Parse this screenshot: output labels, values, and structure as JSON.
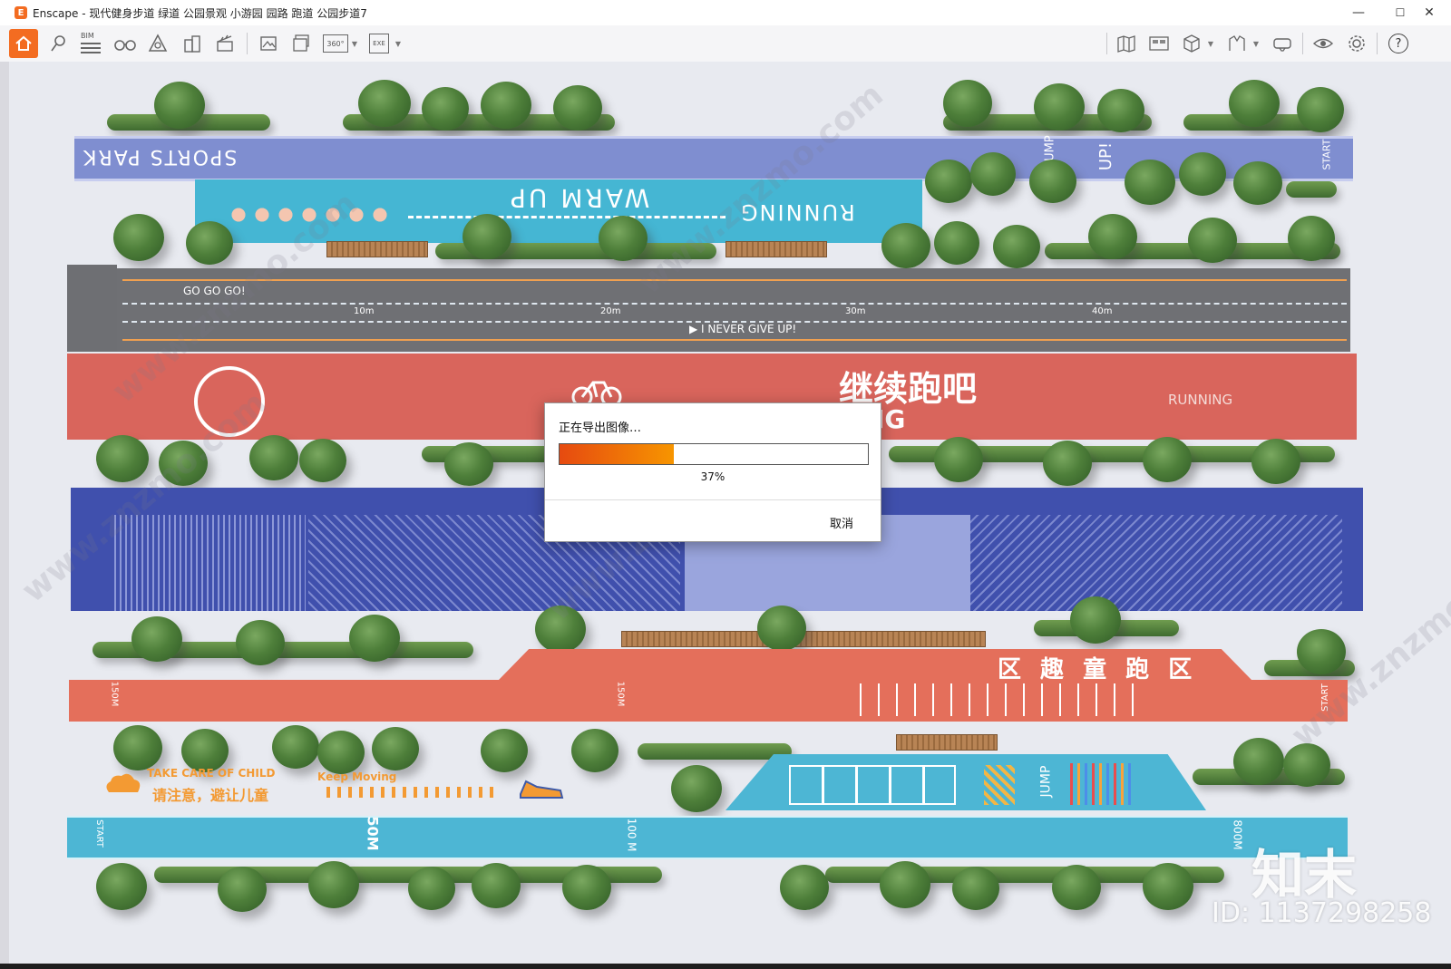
{
  "window": {
    "title": "Enscape - 现代健身步道 绿道 公园景观 小游园 园路 跑道 公园步道7",
    "minimize_glyph": "—",
    "maximize_glyph": "☐",
    "close_glyph": "✕"
  },
  "toolbar": {
    "left_icons": [
      "home-icon",
      "location-pin-icon",
      "bim-icon",
      "binoculars-icon",
      "asset-library-icon",
      "buildings-icon",
      "clapperboard-icon",
      "render-image-icon",
      "batch-render-icon",
      "render-360-icon",
      "export-exe-icon"
    ],
    "bim_label": "BIM",
    "pano_label": "360°",
    "exe_label": "EXE",
    "right_icons": [
      "map-icon",
      "views-icon",
      "cube-icon",
      "material-icon",
      "vr-headset-icon",
      "eye-icon",
      "settings-icon",
      "help-icon"
    ],
    "help_glyph": "?",
    "collapse_glyph": "︿",
    "accent_color": "#f36c21"
  },
  "scene": {
    "sports_park": "SPORTS PARK",
    "jump": "JUMP",
    "up": "UP!",
    "start": "START",
    "warm_up": "WARM UP",
    "running_top": "RUNNING",
    "go_go_go": "GO GO GO!",
    "never_give_up": "▶ I NEVER GIVE UP!",
    "m10": "10m",
    "m20": "20m",
    "m30": "30m",
    "m40": "40m",
    "continue_run": "继续跑吧",
    "ng": "NG",
    "running_red": "RUNNING",
    "take_care": "TAKE CARE OF CHILD",
    "keep_moving": "Keep Moving",
    "please_note": "请注意，避让儿童",
    "zone_text": "区 趣 童 跑 区",
    "m150": "150M",
    "m50": "50M",
    "m100": "100 M",
    "m800": "800M",
    "jump2": "JUMP",
    "start_left": "START",
    "watermark_text": "www.znzmo.com",
    "logo": "知末",
    "id_text": "ID: 1137298258"
  },
  "dialog": {
    "message": "正在导出图像…",
    "progress": 0.37,
    "percent_label": "37%",
    "cancel_label": "取消",
    "bar_colors": [
      "#e64a10",
      "#f79500"
    ]
  }
}
